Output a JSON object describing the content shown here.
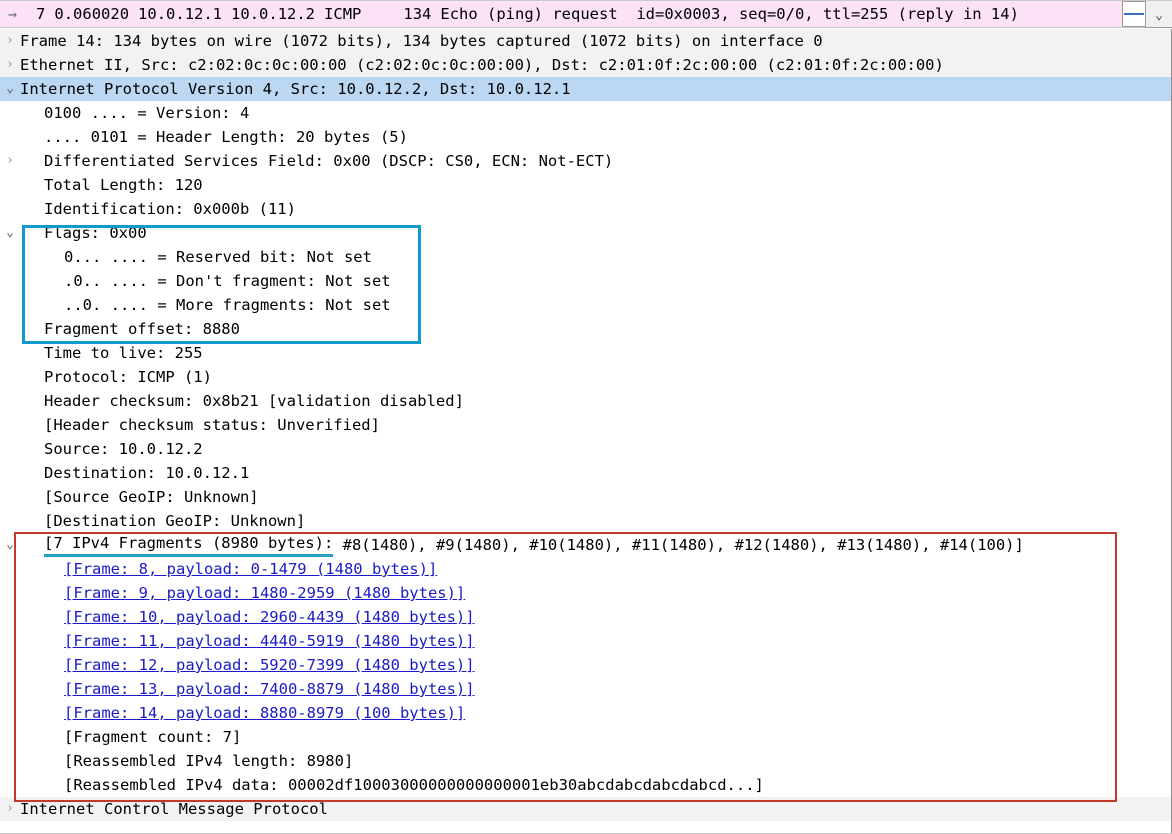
{
  "packet_list": {
    "direction_icon": "arrow-right-icon",
    "no": "7",
    "time": "0.060020",
    "source": "10.0.12.1",
    "destination": "10.0.12.2",
    "protocol": "ICMP",
    "length": "134",
    "info": "Echo (ping) request  id=0x0003, seq=0/0, ttl=255 (reply in 14)",
    "row_bg": "#fbe2f7",
    "scroll_down_icon": "chevron-down-icon"
  },
  "detail_tree": {
    "rows": [
      {
        "id": "frame",
        "indent": 1,
        "twisty": "collapsed",
        "shade": true,
        "text": "Frame 14: 134 bytes on wire (1072 bits), 134 bytes captured (1072 bits) on interface 0"
      },
      {
        "id": "ethernet",
        "indent": 1,
        "twisty": "collapsed",
        "shade": true,
        "text": "Ethernet II, Src: c2:02:0c:0c:00:00 (c2:02:0c:0c:00:00), Dst: c2:01:0f:2c:00:00 (c2:01:0f:2c:00:00)"
      },
      {
        "id": "ipv4",
        "indent": 1,
        "twisty": "expanded",
        "selected": true,
        "text": "Internet Protocol Version 4, Src: 10.0.12.2, Dst: 10.0.12.1"
      },
      {
        "id": "version",
        "indent": 2,
        "twisty": "none",
        "text": "0100 .... = Version: 4"
      },
      {
        "id": "header-length",
        "indent": 2,
        "twisty": "none",
        "text": ".... 0101 = Header Length: 20 bytes (5)"
      },
      {
        "id": "dsfield",
        "indent": 2,
        "twisty": "collapsed",
        "text": "Differentiated Services Field: 0x00 (DSCP: CS0, ECN: Not-ECT)"
      },
      {
        "id": "total-length",
        "indent": 2,
        "twisty": "none",
        "text": "Total Length: 120"
      },
      {
        "id": "identification",
        "indent": 2,
        "twisty": "none",
        "text": "Identification: 0x000b (11)"
      },
      {
        "id": "flags",
        "indent": 2,
        "twisty": "expanded",
        "text": "Flags: 0x00"
      },
      {
        "id": "reserved-bit",
        "indent": 3,
        "twisty": "none",
        "text": "0... .... = Reserved bit: Not set"
      },
      {
        "id": "dont-fragment",
        "indent": 3,
        "twisty": "none",
        "text": ".0.. .... = Don't fragment: Not set"
      },
      {
        "id": "more-fragments",
        "indent": 3,
        "twisty": "none",
        "text": "..0. .... = More fragments: Not set"
      },
      {
        "id": "fragment-offset",
        "indent": 2,
        "twisty": "none",
        "text": "Fragment offset: 8880"
      },
      {
        "id": "time-to-live",
        "indent": 2,
        "twisty": "none",
        "text": "Time to live: 255"
      },
      {
        "id": "protocol",
        "indent": 2,
        "twisty": "none",
        "text": "Protocol: ICMP (1)"
      },
      {
        "id": "header-checksum",
        "indent": 2,
        "twisty": "none",
        "text": "Header checksum: 0x8b21 [validation disabled]"
      },
      {
        "id": "checksum-status",
        "indent": 2,
        "twisty": "none",
        "text": "[Header checksum status: Unverified]"
      },
      {
        "id": "source",
        "indent": 2,
        "twisty": "none",
        "text": "Source: 10.0.12.2"
      },
      {
        "id": "destination",
        "indent": 2,
        "twisty": "none",
        "text": "Destination: 10.0.12.1"
      },
      {
        "id": "source-geoip",
        "indent": 2,
        "twisty": "none",
        "text": "[Source GeoIP: Unknown]"
      },
      {
        "id": "destination-geoip",
        "indent": 2,
        "twisty": "none",
        "text": "[Destination GeoIP: Unknown]"
      },
      {
        "id": "fragments-summary",
        "indent": 2,
        "twisty": "expanded",
        "underline_cyan": true,
        "underline_stop": "[7 IPv4 Fragments (8980 bytes):",
        "text": "[7 IPv4 Fragments (8980 bytes): #8(1480), #9(1480), #10(1480), #11(1480), #12(1480), #13(1480), #14(100)]"
      },
      {
        "id": "fragment-frame-8",
        "indent": 3,
        "twisty": "none",
        "link": true,
        "text": "[Frame: 8, payload: 0-1479 (1480 bytes)]"
      },
      {
        "id": "fragment-frame-9",
        "indent": 3,
        "twisty": "none",
        "link": true,
        "text": "[Frame: 9, payload: 1480-2959 (1480 bytes)]"
      },
      {
        "id": "fragment-frame-10",
        "indent": 3,
        "twisty": "none",
        "link": true,
        "text": "[Frame: 10, payload: 2960-4439 (1480 bytes)]"
      },
      {
        "id": "fragment-frame-11",
        "indent": 3,
        "twisty": "none",
        "link": true,
        "text": "[Frame: 11, payload: 4440-5919 (1480 bytes)]"
      },
      {
        "id": "fragment-frame-12",
        "indent": 3,
        "twisty": "none",
        "link": true,
        "text": "[Frame: 12, payload: 5920-7399 (1480 bytes)]"
      },
      {
        "id": "fragment-frame-13",
        "indent": 3,
        "twisty": "none",
        "link": true,
        "text": "[Frame: 13, payload: 7400-8879 (1480 bytes)]"
      },
      {
        "id": "fragment-frame-14",
        "indent": 3,
        "twisty": "none",
        "link": true,
        "text": "[Frame: 14, payload: 8880-8979 (100 bytes)]"
      },
      {
        "id": "fragment-count",
        "indent": 3,
        "twisty": "none",
        "text": "[Fragment count: 7]"
      },
      {
        "id": "reassembled-length",
        "indent": 3,
        "twisty": "none",
        "text": "[Reassembled IPv4 length: 8980]"
      },
      {
        "id": "reassembled-data",
        "indent": 3,
        "twisty": "none",
        "text": "[Reassembled IPv4 data: 00002df10003000000000000001eb30abcdabcdabcdabcd...]"
      },
      {
        "id": "icmp",
        "indent": 1,
        "twisty": "collapsed",
        "shade": true,
        "text": "Internet Control Message Protocol"
      }
    ]
  },
  "annotations": {
    "flags_box_color": "#0f9bd0",
    "fragments_box_color": "#c0392b",
    "fragments_underline_color": "#21a0c4"
  },
  "icons": {
    "collapsed": "›",
    "expanded": "⌄",
    "arrow_right": "→",
    "chevron_down": "⌄"
  }
}
